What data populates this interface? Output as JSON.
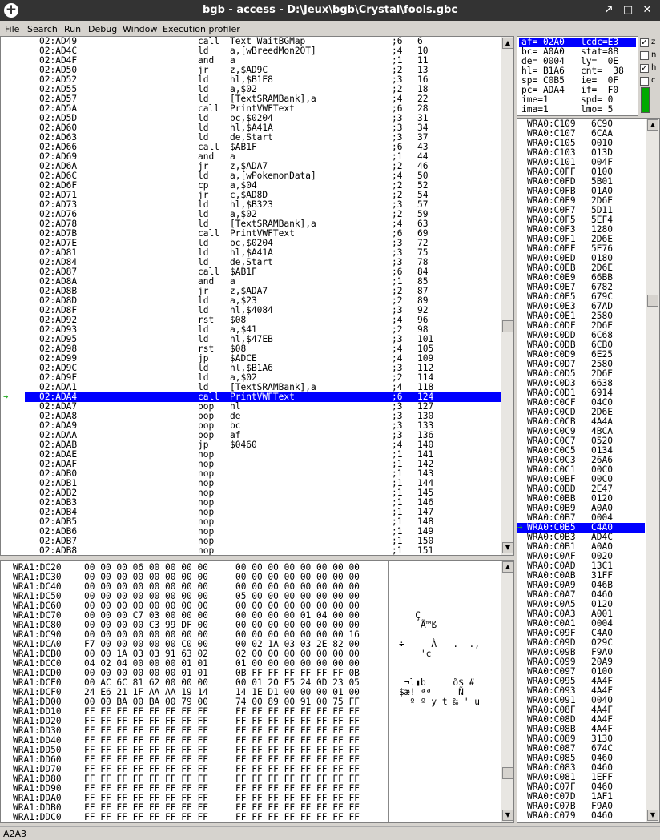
{
  "window": {
    "title": "bgb - access - D:\\Jeux\\bgb\\Crystal\\fools.gbc",
    "min": "🡕",
    "max": "□",
    "close": "✕"
  },
  "menu": [
    "File",
    "Search",
    "Run",
    "Debug",
    "Window",
    "Execution profiler"
  ],
  "disasm": [
    [
      "02:AD49",
      "call",
      "Text_WaitBGMap",
      ";6",
      "6"
    ],
    [
      "02:AD4C",
      "ld",
      "a,[wBreedMon2OT]",
      ";4",
      "10"
    ],
    [
      "02:AD4F",
      "and",
      "a",
      ";1",
      "11"
    ],
    [
      "02:AD50",
      "jr",
      "z,$AD9C",
      ";2",
      "13"
    ],
    [
      "02:AD52",
      "ld",
      "hl,$B1E8",
      ";3",
      "16"
    ],
    [
      "02:AD55",
      "ld",
      "a,$02",
      ";2",
      "18"
    ],
    [
      "02:AD57",
      "ld",
      "[TextSRAMBank],a",
      ";4",
      "22"
    ],
    [
      "02:AD5A",
      "call",
      "PrintVWFText",
      ";6",
      "28"
    ],
    [
      "02:AD5D",
      "ld",
      "bc,$0204",
      ";3",
      "31"
    ],
    [
      "02:AD60",
      "ld",
      "hl,$A41A",
      ";3",
      "34"
    ],
    [
      "02:AD63",
      "ld",
      "de,Start",
      ";3",
      "37"
    ],
    [
      "02:AD66",
      "call",
      "$AB1F",
      ";6",
      "43"
    ],
    [
      "02:AD69",
      "and",
      "a",
      ";1",
      "44"
    ],
    [
      "02:AD6A",
      "jr",
      "z,$ADA7",
      ";2",
      "46"
    ],
    [
      "02:AD6C",
      "ld",
      "a,[wPokemonData]",
      ";4",
      "50"
    ],
    [
      "02:AD6F",
      "cp",
      "a,$04",
      ";2",
      "52"
    ],
    [
      "02:AD71",
      "jr",
      "c,$AD8D",
      ";2",
      "54"
    ],
    [
      "02:AD73",
      "ld",
      "hl,$B323",
      ";3",
      "57"
    ],
    [
      "02:AD76",
      "ld",
      "a,$02",
      ";2",
      "59"
    ],
    [
      "02:AD78",
      "ld",
      "[TextSRAMBank],a",
      ";4",
      "63"
    ],
    [
      "02:AD7B",
      "call",
      "PrintVWFText",
      ";6",
      "69"
    ],
    [
      "02:AD7E",
      "ld",
      "bc,$0204",
      ";3",
      "72"
    ],
    [
      "02:AD81",
      "ld",
      "hl,$A41A",
      ";3",
      "75"
    ],
    [
      "02:AD84",
      "ld",
      "de,Start",
      ";3",
      "78"
    ],
    [
      "02:AD87",
      "call",
      "$AB1F",
      ";6",
      "84"
    ],
    [
      "02:AD8A",
      "and",
      "a",
      ";1",
      "85"
    ],
    [
      "02:AD8B",
      "jr",
      "z,$ADA7",
      ";2",
      "87"
    ],
    [
      "02:AD8D",
      "ld",
      "a,$23",
      ";2",
      "89"
    ],
    [
      "02:AD8F",
      "ld",
      "hl,$4084",
      ";3",
      "92"
    ],
    [
      "02:AD92",
      "rst",
      "$08",
      ";4",
      "96"
    ],
    [
      "02:AD93",
      "ld",
      "a,$41",
      ";2",
      "98"
    ],
    [
      "02:AD95",
      "ld",
      "hl,$47EB",
      ";3",
      "101"
    ],
    [
      "02:AD98",
      "rst",
      "$08",
      ";4",
      "105"
    ],
    [
      "02:AD99",
      "jp",
      "$ADCE",
      ";4",
      "109"
    ],
    [
      "02:AD9C",
      "ld",
      "hl,$B1A6",
      ";3",
      "112"
    ],
    [
      "02:AD9F",
      "ld",
      "a,$02",
      ";2",
      "114"
    ],
    [
      "02:ADA1",
      "ld",
      "[TextSRAMBank],a",
      ";4",
      "118"
    ],
    [
      "02:ADA4",
      "call",
      "PrintVWFText",
      ";6",
      "124"
    ],
    [
      "02:ADA7",
      "pop",
      "hl",
      ";3",
      "127"
    ],
    [
      "02:ADA8",
      "pop",
      "de",
      ";3",
      "130"
    ],
    [
      "02:ADA9",
      "pop",
      "bc",
      ";3",
      "133"
    ],
    [
      "02:ADAA",
      "pop",
      "af",
      ";3",
      "136"
    ],
    [
      "02:ADAB",
      "jp",
      "$0460",
      ";4",
      "140"
    ],
    [
      "02:ADAE",
      "nop",
      "",
      ";1",
      "141"
    ],
    [
      "02:ADAF",
      "nop",
      "",
      ";1",
      "142"
    ],
    [
      "02:ADB0",
      "nop",
      "",
      ";1",
      "143"
    ],
    [
      "02:ADB1",
      "nop",
      "",
      ";1",
      "144"
    ],
    [
      "02:ADB2",
      "nop",
      "",
      ";1",
      "145"
    ],
    [
      "02:ADB3",
      "nop",
      "",
      ";1",
      "146"
    ],
    [
      "02:ADB4",
      "nop",
      "",
      ";1",
      "147"
    ],
    [
      "02:ADB5",
      "nop",
      "",
      ";1",
      "148"
    ],
    [
      "02:ADB6",
      "nop",
      "",
      ";1",
      "149"
    ],
    [
      "02:ADB7",
      "nop",
      "",
      ";1",
      "150"
    ],
    [
      "02:ADB8",
      "nop",
      "",
      ";1",
      "151"
    ]
  ],
  "pc_index": 37,
  "regs": [
    [
      "af= 02A0",
      "lcdc=E3"
    ],
    [
      "bc= A0A0",
      "stat=8B"
    ],
    [
      "de= 0004",
      "ly=  0E"
    ],
    [
      "hl= B1A6",
      "cnt=  38"
    ],
    [
      "sp= C0B5",
      "ie=  0F"
    ],
    [
      "pc= ADA4",
      "if=  F0"
    ],
    [
      "ime=1",
      "spd= 0"
    ],
    [
      "ima=1",
      "lmo= 5"
    ]
  ],
  "flags": [
    {
      "name": "z",
      "checked": true
    },
    {
      "name": "n",
      "checked": false
    },
    {
      "name": "h",
      "checked": true
    },
    {
      "name": "c",
      "checked": false
    }
  ],
  "stack": [
    [
      "WRA0:C109",
      "6C90"
    ],
    [
      "WRA0:C107",
      "6CAA"
    ],
    [
      "WRA0:C105",
      "0010"
    ],
    [
      "WRA0:C103",
      "013D"
    ],
    [
      "WRA0:C101",
      "004F"
    ],
    [
      "WRA0:C0FF",
      "0100"
    ],
    [
      "WRA0:C0FD",
      "5B01"
    ],
    [
      "WRA0:C0FB",
      "01A0"
    ],
    [
      "WRA0:C0F9",
      "2D6E"
    ],
    [
      "WRA0:C0F7",
      "5D11"
    ],
    [
      "WRA0:C0F5",
      "5EF4"
    ],
    [
      "WRA0:C0F3",
      "1280"
    ],
    [
      "WRA0:C0F1",
      "2D6E"
    ],
    [
      "WRA0:C0EF",
      "5E76"
    ],
    [
      "WRA0:C0ED",
      "0180"
    ],
    [
      "WRA0:C0EB",
      "2D6E"
    ],
    [
      "WRA0:C0E9",
      "66BB"
    ],
    [
      "WRA0:C0E7",
      "6782"
    ],
    [
      "WRA0:C0E5",
      "679C"
    ],
    [
      "WRA0:C0E3",
      "67AD"
    ],
    [
      "WRA0:C0E1",
      "2580"
    ],
    [
      "WRA0:C0DF",
      "2D6E"
    ],
    [
      "WRA0:C0DD",
      "6C68"
    ],
    [
      "WRA0:C0DB",
      "6CB0"
    ],
    [
      "WRA0:C0D9",
      "6E25"
    ],
    [
      "WRA0:C0D7",
      "2580"
    ],
    [
      "WRA0:C0D5",
      "2D6E"
    ],
    [
      "WRA0:C0D3",
      "6638"
    ],
    [
      "WRA0:C0D1",
      "6914"
    ],
    [
      "WRA0:C0CF",
      "04C0"
    ],
    [
      "WRA0:C0CD",
      "2D6E"
    ],
    [
      "WRA0:C0CB",
      "4A4A"
    ],
    [
      "WRA0:C0C9",
      "4BCA"
    ],
    [
      "WRA0:C0C7",
      "0520"
    ],
    [
      "WRA0:C0C5",
      "0134"
    ],
    [
      "WRA0:C0C3",
      "26A6"
    ],
    [
      "WRA0:C0C1",
      "00C0"
    ],
    [
      "WRA0:C0BF",
      "00C0"
    ],
    [
      "WRA0:C0BD",
      "2E47"
    ],
    [
      "WRA0:C0BB",
      "0120"
    ],
    [
      "WRA0:C0B9",
      "A0A0"
    ],
    [
      "WRA0:C0B7",
      "0004"
    ],
    [
      "WRA0:C0B5",
      "C4A0"
    ],
    [
      "WRA0:C0B3",
      "AD4C"
    ],
    [
      "WRA0:C0B1",
      "A0A0"
    ],
    [
      "WRA0:C0AF",
      "0020"
    ],
    [
      "WRA0:C0AD",
      "13C1"
    ],
    [
      "WRA0:C0AB",
      "31FF"
    ],
    [
      "WRA0:C0A9",
      "046B"
    ],
    [
      "WRA0:C0A7",
      "0460"
    ],
    [
      "WRA0:C0A5",
      "0120"
    ],
    [
      "WRA0:C0A3",
      "A001"
    ],
    [
      "WRA0:C0A1",
      "0004"
    ],
    [
      "WRA0:C09F",
      "C4A0"
    ],
    [
      "WRA0:C09D",
      "029C"
    ],
    [
      "WRA0:C09B",
      "F9A0"
    ],
    [
      "WRA0:C099",
      "20A9"
    ],
    [
      "WRA0:C097",
      "0100"
    ],
    [
      "WRA0:C095",
      "4A4F"
    ],
    [
      "WRA0:C093",
      "4A4F"
    ],
    [
      "WRA0:C091",
      "0040"
    ],
    [
      "WRA0:C08F",
      "4A4F"
    ],
    [
      "WRA0:C08D",
      "4A4F"
    ],
    [
      "WRA0:C08B",
      "4A4F"
    ],
    [
      "WRA0:C089",
      "3130"
    ],
    [
      "WRA0:C087",
      "674C"
    ],
    [
      "WRA0:C085",
      "0460"
    ],
    [
      "WRA0:C083",
      "0460"
    ],
    [
      "WRA0:C081",
      "1EFF"
    ],
    [
      "WRA0:C07F",
      "0460"
    ],
    [
      "WRA0:C07D",
      "1AF1"
    ],
    [
      "WRA0:C07B",
      "F9A0"
    ],
    [
      "WRA0:C079",
      "0460"
    ]
  ],
  "sp_index": 42,
  "hex": [
    [
      "WRA1:DC20",
      "00 00 00 06 00 00 00 00",
      "00 00 00 00 00 00 00 00",
      ""
    ],
    [
      "WRA1:DC30",
      "00 00 00 00 00 00 00 00",
      "00 00 00 00 00 00 00 00",
      ""
    ],
    [
      "WRA1:DC40",
      "00 00 00 00 00 00 00 00",
      "00 00 00 00 00 00 00 00",
      ""
    ],
    [
      "WRA1:DC50",
      "00 00 00 00 00 00 00 00",
      "05 00 00 00 00 00 00 00",
      ""
    ],
    [
      "WRA1:DC60",
      "00 00 00 00 00 00 00 00",
      "00 00 00 00 00 00 00 00",
      ""
    ],
    [
      "WRA1:DC70",
      "00 00 00 C7 03 00 00 00",
      "00 00 00 00 01 04 00 00",
      "   Ç"
    ],
    [
      "WRA1:DC80",
      "00 00 00 00 C3 99 DF 00",
      "00 00 00 00 00 00 00 00",
      "    Ã™ß"
    ],
    [
      "WRA1:DC90",
      "00 00 00 00 00 00 00 00",
      "00 00 00 00 00 00 00 16",
      ""
    ],
    [
      "WRA1:DCA0",
      "F7 00 00 00 00 00 C0 00",
      "00 02 1A 03 03 2E 82 00",
      "÷     À   .  .‚"
    ],
    [
      "WRA1:DCB0",
      "00 00 1A 03 03 91 63 02",
      "02 00 00 00 00 00 00 00",
      "    'c"
    ],
    [
      "WRA1:DCC0",
      "04 02 04 00 00 00 01 01",
      "01 00 00 00 00 00 00 00",
      ""
    ],
    [
      "WRA1:DCD0",
      "00 00 00 00 00 00 01 01",
      "0B FF FF FF FF FF FF 0B",
      ""
    ],
    [
      "WRA1:DCE0",
      "00 AC 6C 81 62 00 00 00",
      "00 01 20 F5 24 0D 23 05",
      " ¬l▮b     õ$ #"
    ],
    [
      "WRA1:DCF0",
      "24 E6 21 1F AA AA 19 14",
      "14 1E D1 00 00 00 01 00",
      "$æ! ªª     Ñ"
    ],
    [
      "WRA1:DD00",
      "00 00 BA 00 BA 00 79 00",
      "74 00 89 00 91 00 75 FF",
      "  º º y t ‰ ' u"
    ],
    [
      "WRA1:DD10",
      "FF FF FF FF FF FF FF FF",
      "FF FF FF FF FF FF FF FF",
      ""
    ],
    [
      "WRA1:DD20",
      "FF FF FF FF FF FF FF FF",
      "FF FF FF FF FF FF FF FF",
      ""
    ],
    [
      "WRA1:DD30",
      "FF FF FF FF FF FF FF FF",
      "FF FF FF FF FF FF FF FF",
      ""
    ],
    [
      "WRA1:DD40",
      "FF FF FF FF FF FF FF FF",
      "FF FF FF FF FF FF FF FF",
      ""
    ],
    [
      "WRA1:DD50",
      "FF FF FF FF FF FF FF FF",
      "FF FF FF FF FF FF FF FF",
      ""
    ],
    [
      "WRA1:DD60",
      "FF FF FF FF FF FF FF FF",
      "FF FF FF FF FF FF FF FF",
      ""
    ],
    [
      "WRA1:DD70",
      "FF FF FF FF FF FF FF FF",
      "FF FF FF FF FF FF FF FF",
      ""
    ],
    [
      "WRA1:DD80",
      "FF FF FF FF FF FF FF FF",
      "FF FF FF FF FF FF FF FF",
      ""
    ],
    [
      "WRA1:DD90",
      "FF FF FF FF FF FF FF FF",
      "FF FF FF FF FF FF FF FF",
      ""
    ],
    [
      "WRA1:DDA0",
      "FF FF FF FF FF FF FF FF",
      "FF FF FF FF FF FF FF FF",
      ""
    ],
    [
      "WRA1:DDB0",
      "FF FF FF FF FF FF FF FF",
      "FF FF FF FF FF FF FF FF",
      ""
    ],
    [
      "WRA1:DDC0",
      "FF FF FF FF FF FF FF FF",
      "FF FF FF FF FF FF FF FF",
      ""
    ]
  ],
  "status": "A2A3",
  "colors": {
    "selection": "#0000ff",
    "titlebar": "#333333",
    "indicator_green": "#22cc22"
  }
}
